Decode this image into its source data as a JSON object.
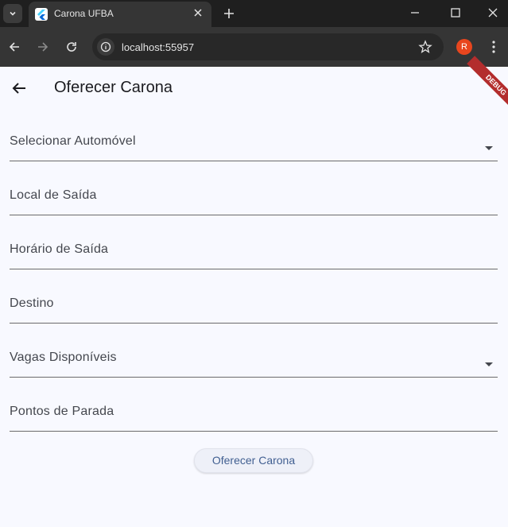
{
  "browser": {
    "tab_title": "Carona UFBA",
    "url": "localhost:55957",
    "profile_initial": "R"
  },
  "app": {
    "title": "Oferecer Carona",
    "debug_banner": "DEBUG",
    "fields": [
      {
        "label": "Selecionar Automóvel",
        "dropdown": true
      },
      {
        "label": "Local de Saída",
        "dropdown": false
      },
      {
        "label": "Horário de Saída",
        "dropdown": false
      },
      {
        "label": "Destino",
        "dropdown": false
      },
      {
        "label": "Vagas Disponíveis",
        "dropdown": true
      },
      {
        "label": "Pontos de Parada",
        "dropdown": false
      }
    ],
    "submit_label": "Oferecer Carona"
  },
  "colors": {
    "background": "#f8f9ff",
    "accent": "#415f91",
    "debug": "#b32d2d"
  }
}
